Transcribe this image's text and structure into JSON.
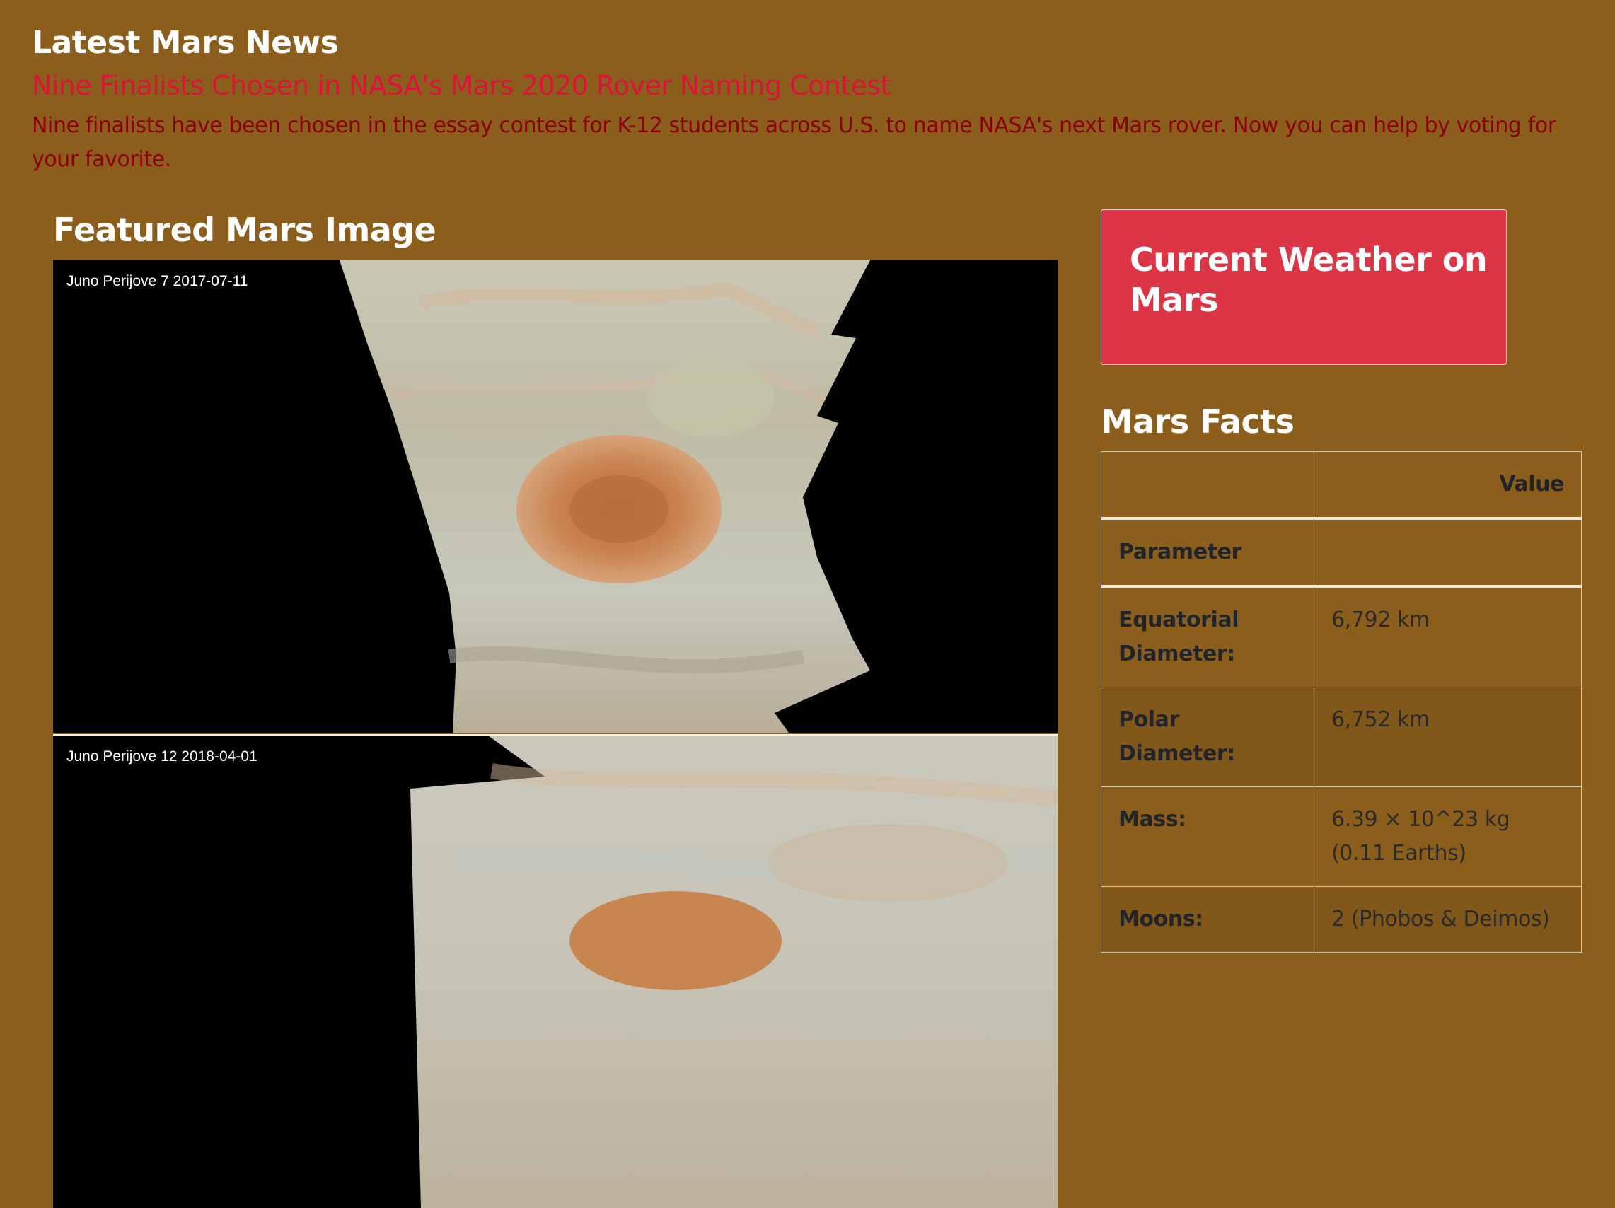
{
  "news": {
    "section_title": "Latest Mars News",
    "headline": "Nine Finalists Chosen in NASA's Mars 2020 Rover Naming Contest",
    "teaser": "Nine finalists have been chosen in the essay contest for K-12 students across U.S. to name NASA's next Mars rover. Now you can help by voting for your favorite."
  },
  "featured": {
    "title": "Featured Mars Image",
    "images": [
      {
        "caption": "Juno Perijove 7 2017-07-11"
      },
      {
        "caption": "Juno Perijove 12 2018-04-01"
      }
    ]
  },
  "weather": {
    "title": "Current Weather on Mars"
  },
  "facts": {
    "title": "Mars Facts",
    "header_col1": "",
    "header_col2": "Value",
    "index_label": "Parameter",
    "rows": [
      {
        "param": "Equatorial Diameter:",
        "value": "6,792 km"
      },
      {
        "param": "Polar Diameter:",
        "value": "6,752 km"
      },
      {
        "param": "Mass:",
        "value": "6.39 × 10^23 kg (0.11 Earths)"
      },
      {
        "param": "Moons:",
        "value": "2 (Phobos & Deimos)"
      }
    ]
  },
  "colors": {
    "background": "#8b5e1c",
    "headline": "#dc143c",
    "teaser": "#8b0000",
    "weather_box": "#dc3545"
  }
}
